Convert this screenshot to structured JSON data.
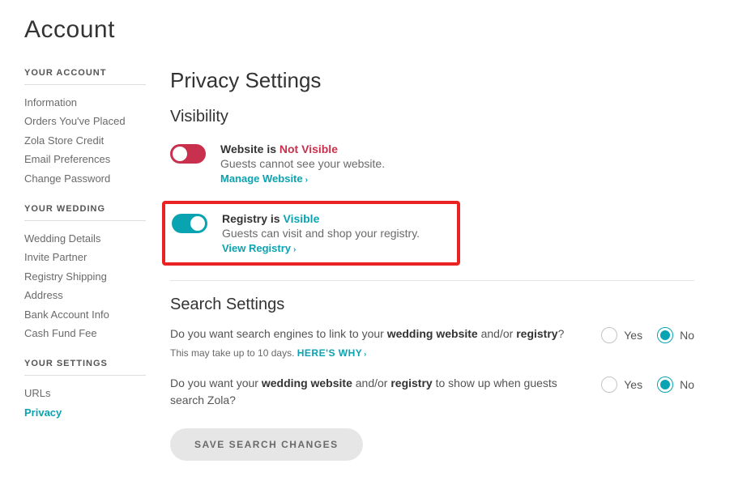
{
  "page": {
    "title": "Account"
  },
  "sidebar": {
    "groups": [
      {
        "heading": "YOUR ACCOUNT",
        "items": [
          "Information",
          "Orders You've Placed",
          "Zola Store Credit",
          "Email Preferences",
          "Change Password"
        ]
      },
      {
        "heading": "YOUR WEDDING",
        "items": [
          "Wedding Details",
          "Invite Partner",
          "Registry Shipping Address",
          "Bank Account Info",
          "Cash Fund Fee"
        ]
      },
      {
        "heading": "YOUR SETTINGS",
        "items": [
          "URLs",
          "Privacy"
        ],
        "active": 1
      }
    ]
  },
  "main": {
    "title": "Privacy Settings",
    "visibility": {
      "title": "Visibility",
      "website": {
        "label": "Website is",
        "status": "Not Visible",
        "desc": "Guests cannot see your website.",
        "link": "Manage Website"
      },
      "registry": {
        "label": "Registry is",
        "status": "Visible",
        "desc": "Guests can visit and shop your registry.",
        "link": "View Registry"
      }
    },
    "search": {
      "title": "Search Settings",
      "q1_pre": "Do you want search engines to link to your ",
      "q1_b1": "wedding website",
      "q1_mid": " and/or ",
      "q1_b2": "registry",
      "q1_post": "?",
      "q1_note_pre": "This may take up to 10 days. ",
      "q1_note_link": "HERE'S WHY",
      "q2_pre": "Do you want your ",
      "q2_b1": "wedding website",
      "q2_mid": " and/or ",
      "q2_b2": "registry",
      "q2_post": " to show up when guests search Zola?",
      "yes": "Yes",
      "no": "No",
      "save": "SAVE SEARCH CHANGES"
    }
  }
}
